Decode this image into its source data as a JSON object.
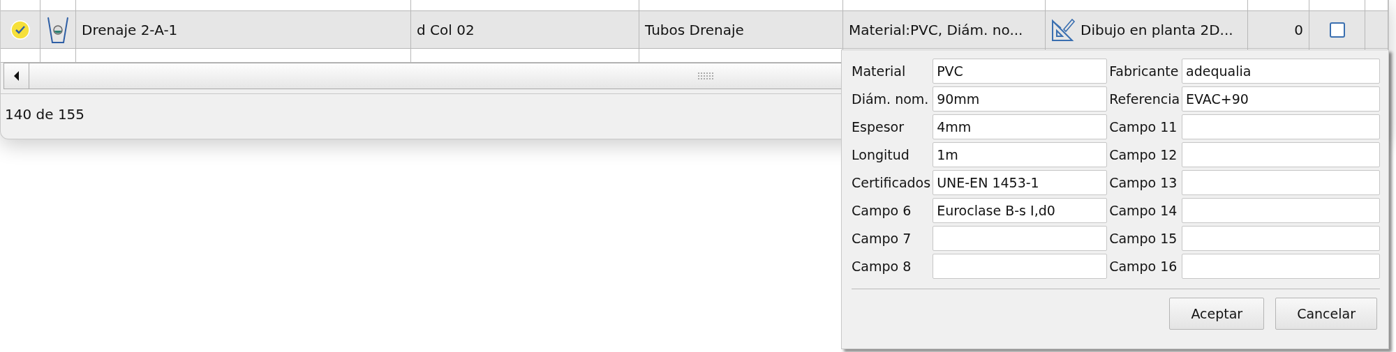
{
  "table": {
    "rows": [
      {
        "selected": true,
        "checked": true,
        "name": "Drenaje 2-A-1",
        "column_3": "d Col 02",
        "column_4": "Tubos Drenaje",
        "properties": "Material:PVC, Diám. no...",
        "drawing": "Dibujo en planta 2D...",
        "count": "0",
        "flag": false
      }
    ]
  },
  "status_bar": {
    "text": "140 de 155"
  },
  "dialog": {
    "fields": [
      {
        "label": "Material",
        "value": "PVC"
      },
      {
        "label": "Fabricante",
        "value": "adequalia"
      },
      {
        "label": "Diám. nom.",
        "value": "90mm"
      },
      {
        "label": "Referencia",
        "value": "EVAC+90"
      },
      {
        "label": "Espesor",
        "value": "4mm"
      },
      {
        "label": "Campo 11"
      },
      {
        "label": "Longitud",
        "value": "1m"
      },
      {
        "label": "Campo 12"
      },
      {
        "label": "Certificados",
        "value": "UNE-EN 1453-1"
      },
      {
        "label": "Campo 13"
      },
      {
        "label": "Campo 6",
        "value": "Euroclase B-s I,d0"
      },
      {
        "label": "Campo 14"
      },
      {
        "label": "Campo 7"
      },
      {
        "label": "Campo 15"
      },
      {
        "label": "Campo 8"
      },
      {
        "label": "Campo 16"
      }
    ],
    "buttons": [
      "Aceptar",
      "Cancelar"
    ]
  }
}
